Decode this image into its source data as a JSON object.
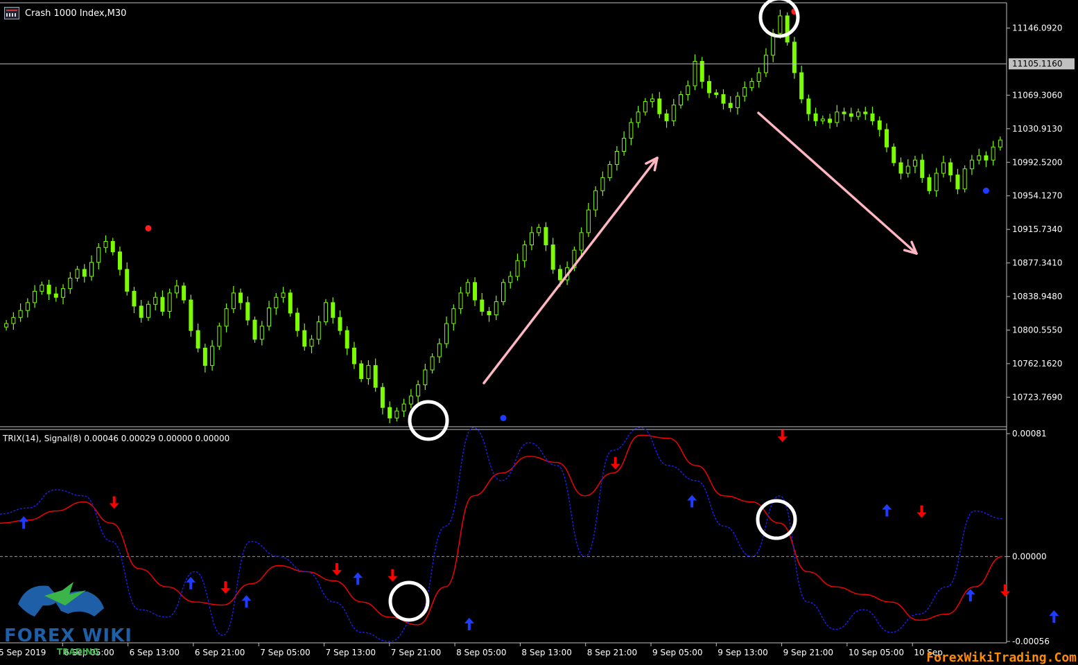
{
  "window": {
    "title": "Crash 1000 Index,M30",
    "indicator_label": "TRIX(14), Signal(8) 0.00046 0.00029 0.00000 0.00000"
  },
  "watermark": "ForexWikiTrading.Com",
  "logo": {
    "text": "FOREX WIKI",
    "subtext": "TRADING"
  },
  "colors": {
    "background": "#000000",
    "bull_candle": "#7cfc00",
    "trix_line": "#ff0000",
    "signal_line": "#1e1ef0",
    "arrow_up": "#1e3cff",
    "arrow_down": "#ff0000",
    "trend_arrow": "#ffb6c1",
    "grid_line": "#c0c0c0"
  },
  "icons": {
    "up_signal": "arrow-up-icon",
    "down_signal": "arrow-down-icon",
    "chart_window": "chart-window-icon"
  },
  "chart_data": [
    {
      "type": "candlestick",
      "title": "Crash 1000 Index,M30",
      "current_price_label": "11105.1160",
      "current_price": 11105.116,
      "y_ticks": [
        "11146.0920",
        "11069.3060",
        "11030.9130",
        "10992.5200",
        "10954.1270",
        "10915.7340",
        "10877.3410",
        "10838.9480",
        "10800.5550",
        "10762.1620",
        "10723.7690"
      ],
      "ylim": [
        10690,
        11175
      ],
      "x_labels": [
        "5 Sep 2019",
        "6 Sep 05:00",
        "6 Sep 13:00",
        "6 Sep 21:00",
        "7 Sep 05:00",
        "7 Sep 13:00",
        "7 Sep 21:00",
        "8 Sep 05:00",
        "8 Sep 13:00",
        "8 Sep 21:00",
        "9 Sep 05:00",
        "9 Sep 13:00",
        "9 Sep 21:00",
        "10 Sep 05:00",
        "10 Sep"
      ],
      "close_path": [
        10808,
        10815,
        10823,
        10832,
        10845,
        10852,
        10842,
        10838,
        10848,
        10860,
        10870,
        10862,
        10878,
        10895,
        10902,
        10890,
        10870,
        10845,
        10828,
        10815,
        10830,
        10838,
        10822,
        10843,
        10851,
        10835,
        10800,
        10780,
        10760,
        10782,
        10805,
        10825,
        10843,
        10832,
        10812,
        10790,
        10805,
        10826,
        10838,
        10843,
        10820,
        10800,
        10782,
        10790,
        10810,
        10832,
        10815,
        10800,
        10780,
        10762,
        10745,
        10760,
        10735,
        10712,
        10700,
        10708,
        10716,
        10725,
        10738,
        10755,
        10770,
        10785,
        10808,
        10825,
        10843,
        10855,
        10835,
        10822,
        10818,
        10833,
        10855,
        10862,
        10880,
        10898,
        10912,
        10918,
        10898,
        10870,
        10858,
        10872,
        10892,
        10912,
        10938,
        10960,
        10975,
        10990,
        11005,
        11020,
        11038,
        11050,
        11062,
        11065,
        11048,
        11040,
        11058,
        11070,
        11080,
        11108,
        11085,
        11072,
        11070,
        11060,
        11055,
        11068,
        11078,
        11085,
        11095,
        11115,
        11140,
        11160,
        11130,
        11095,
        11065,
        11048,
        11040,
        11042,
        11038,
        11050,
        11048,
        11045,
        11050,
        11048,
        11040,
        11030,
        11010,
        10992,
        10980,
        10988,
        10995,
        10975,
        10960,
        10980,
        10992,
        10978,
        10962,
        10985,
        10995,
        11000,
        10995,
        11010,
        11018
      ],
      "annotations": [
        {
          "kind": "dot",
          "color": "red",
          "at_index": 20,
          "value": 10917
        },
        {
          "kind": "dot",
          "color": "blue",
          "at_index": 70,
          "value": 10700
        },
        {
          "kind": "dot",
          "color": "red",
          "at_index": 111,
          "value": 11165
        },
        {
          "kind": "dot",
          "color": "blue",
          "at_index": 138,
          "value": 10960
        }
      ]
    },
    {
      "type": "line",
      "title": "TRIX(14), Signal(8) 0.00046 0.00029 0.00000 0.00000",
      "y_ticks": [
        "0.00081",
        "0.00000",
        "-0.00056"
      ],
      "ylim": [
        -0.00056,
        0.00081
      ],
      "zero_line": 0.0,
      "series": [
        {
          "name": "TRIX(14)",
          "style": "solid",
          "color": "#ff0000",
          "values": [
            0.00022,
            0.00024,
            0.0003,
            0.00036,
            0.00022,
            -8e-05,
            -0.0002,
            -0.0003,
            -0.00032,
            -0.00018,
            -6e-05,
            -0.0001,
            -0.00016,
            -0.0003,
            -0.0004,
            -0.00045,
            -0.0002,
            0.0004,
            0.00055,
            0.00066,
            0.00062,
            0.0004,
            0.00055,
            0.0008,
            0.00078,
            0.0006,
            0.0004,
            0.00036,
            0.00022,
            -0.0001,
            -0.0002,
            -0.00025,
            -0.0003,
            -0.00042,
            -0.00038,
            -0.0002,
            0.0
          ]
        },
        {
          "name": "Signal(8)",
          "style": "dotted",
          "color": "#1e1ef0",
          "values": [
            0.00028,
            0.00032,
            0.00044,
            0.0004,
            0.0001,
            -0.00035,
            -0.0004,
            -0.0001,
            -0.00052,
            0.0001,
            0.0,
            -0.0001,
            -0.0003,
            -0.0005,
            -0.00056,
            -0.0004,
            0.0002,
            0.00085,
            0.0005,
            0.00075,
            0.0006,
            0.0,
            0.0007,
            0.00085,
            0.0006,
            0.0005,
            0.0002,
            0.0,
            0.0004,
            -0.0003,
            -0.00048,
            -0.00035,
            -0.0005,
            -0.00038,
            -0.0002,
            0.0003,
            0.00025
          ]
        }
      ],
      "signals": [
        {
          "dir": "up",
          "index": 1,
          "value": 0.00022
        },
        {
          "dir": "down",
          "index": 4,
          "value": 0.00036
        },
        {
          "dir": "up",
          "index": 7,
          "value": -0.00018
        },
        {
          "dir": "down",
          "index": 8,
          "value": -0.0002
        },
        {
          "dir": "up",
          "index": 9,
          "value": -0.0003
        },
        {
          "dir": "down",
          "index": 12,
          "value": -8e-05
        },
        {
          "dir": "up",
          "index": 13,
          "value": -0.00015
        },
        {
          "dir": "down",
          "index": 14,
          "value": -0.00012
        },
        {
          "dir": "up",
          "index": 17,
          "value": -0.00045
        },
        {
          "dir": "down",
          "index": 22,
          "value": 0.00062
        },
        {
          "dir": "up",
          "index": 25,
          "value": 0.00036
        },
        {
          "dir": "down",
          "index": 28,
          "value": 0.0008
        },
        {
          "dir": "up",
          "index": 32,
          "value": 0.0003
        },
        {
          "dir": "down",
          "index": 33,
          "value": 0.0003
        },
        {
          "dir": "up",
          "index": 35,
          "value": -0.00026
        },
        {
          "dir": "down",
          "index": 36,
          "value": -0.00022
        },
        {
          "dir": "up",
          "index": 38,
          "value": -0.0004
        }
      ]
    }
  ]
}
